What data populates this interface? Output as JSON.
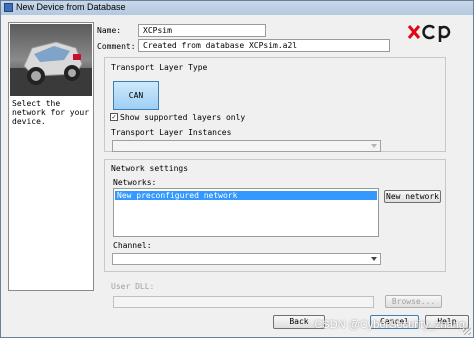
{
  "window": {
    "title": "New Device from Database"
  },
  "side_panel": {
    "description": "Select the network for your device."
  },
  "form": {
    "name_label": "Name:",
    "name_value": "XCPsim",
    "comment_label": "Comment:",
    "comment_value": "Created from database XCPsim.a2l"
  },
  "logo": {
    "text": "xcp",
    "colors": {
      "x": "#e30613",
      "cp": "#1a1a1a"
    }
  },
  "transport_layer_type": {
    "label": "Transport Layer Type",
    "can_button": "CAN",
    "show_supported_label": "Show supported layers only",
    "show_supported_checked": true
  },
  "transport_layer_instances": {
    "label": "Transport Layer Instances",
    "selected": ""
  },
  "network_settings": {
    "label": "Network settings",
    "networks_label": "Networks:",
    "networks": [
      "New preconfigured network"
    ],
    "new_network_button": "New network",
    "channel_label": "Channel:",
    "channel_selected": ""
  },
  "user_dll": {
    "label": "User DLL:",
    "value": "",
    "browse_button": "Browse..."
  },
  "footer": {
    "back_button": "Back",
    "cancel_button": "Cancel",
    "help_button": "Help"
  },
  "watermark": "CSDN @CyberSecurity_zhang"
}
